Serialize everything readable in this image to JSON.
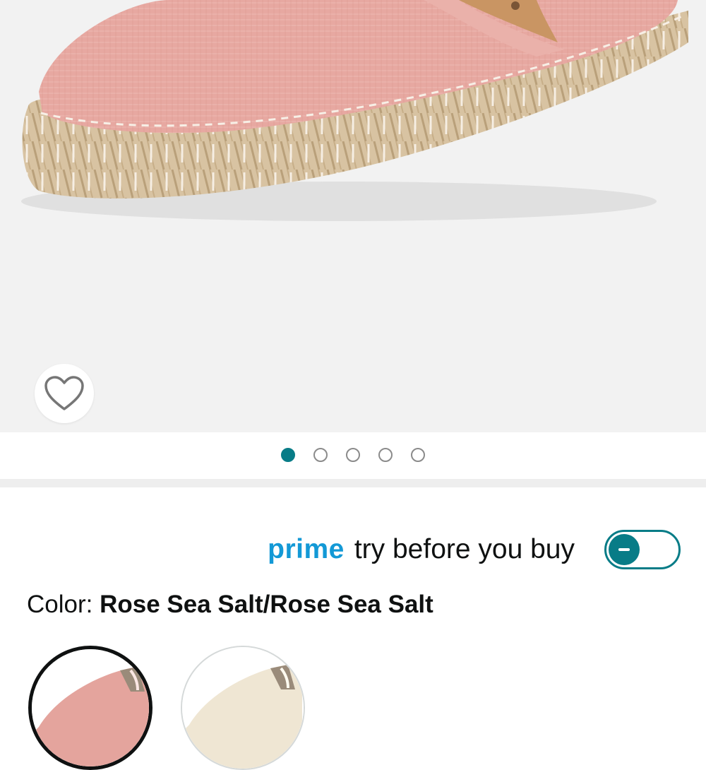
{
  "product_gallery": {
    "image_alt": "Rose espadrille slip-on shoe",
    "image_count": 5,
    "active_index": 0,
    "wishlist_icon": "heart-outline-icon"
  },
  "prime_try": {
    "brand": "prime",
    "text": "try before you buy",
    "toggle_state": "off",
    "accent": "#087c87",
    "brand_color": "#1399d6"
  },
  "color_selector": {
    "label": "Color:",
    "selected_value": "Rose Sea Salt/Rose Sea Salt",
    "swatches": [
      {
        "name": "Rose Sea Salt",
        "selected": true
      },
      {
        "name": "Cream",
        "selected": false
      }
    ]
  }
}
